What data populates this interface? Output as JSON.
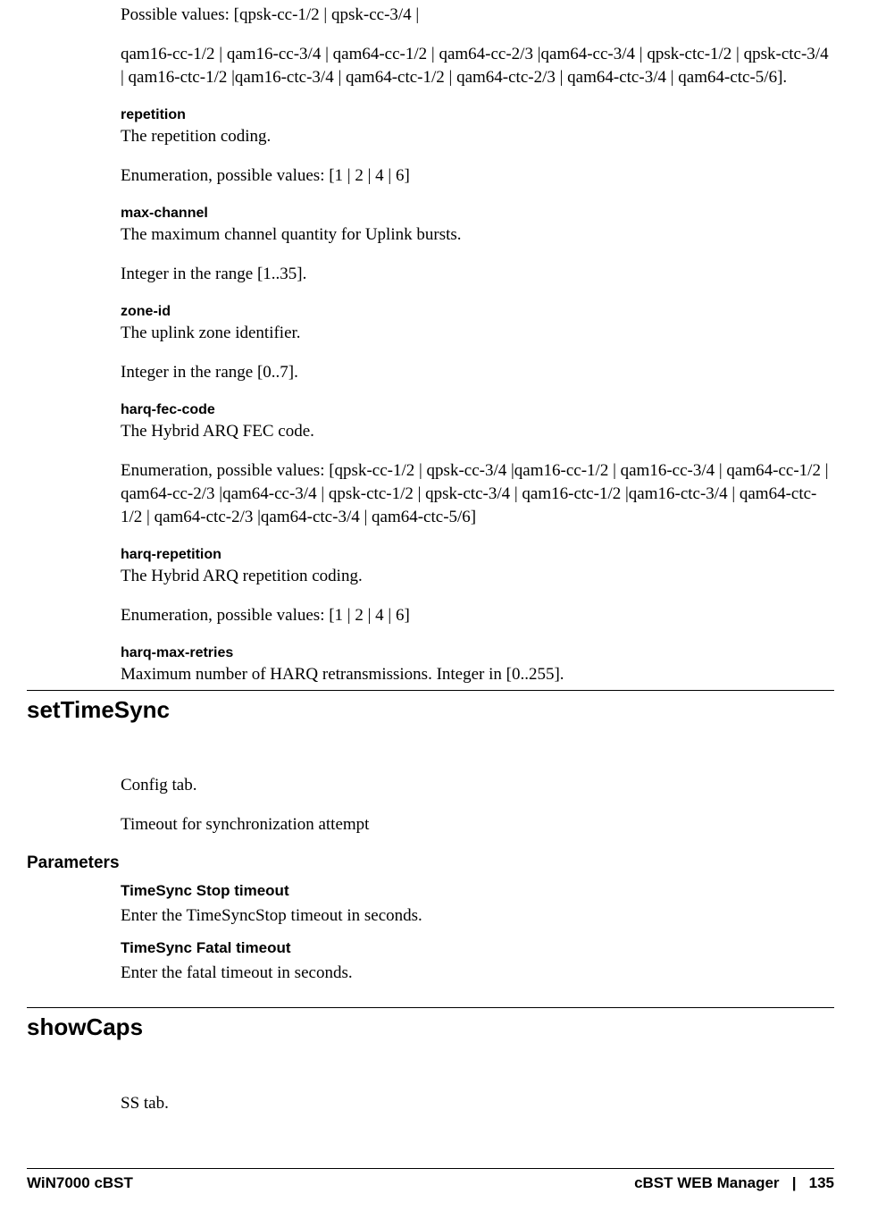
{
  "intro": {
    "possible_prefix": "Possible values: [qpsk-cc-1/2 | qpsk-cc-3/4 |",
    "possible_rest": "qam16-cc-1/2 | qam16-cc-3/4 | qam64-cc-1/2 | qam64-cc-2/3 |qam64-cc-3/4 | qpsk-ctc-1/2 | qpsk-ctc-3/4 | qam16-ctc-1/2 |qam16-ctc-3/4 | qam64-ctc-1/2 | qam64-ctc-2/3 | qam64-ctc-3/4 | qam64-ctc-5/6]."
  },
  "params1": [
    {
      "name": "repetition",
      "desc": "The repetition coding.",
      "extra": "Enumeration, possible values: [1 | 2 | 4 | 6]"
    },
    {
      "name": "max-channel",
      "desc": "The maximum channel quantity for Uplink bursts.",
      "extra": "Integer in the range [1..35]."
    },
    {
      "name": "zone-id",
      "desc": "The uplink zone identifier.",
      "extra": "Integer in the range [0..7]."
    },
    {
      "name": "harq-fec-code",
      "desc": "The Hybrid ARQ FEC code.",
      "extra": "Enumeration, possible values: [qpsk-cc-1/2 | qpsk-cc-3/4 |qam16-cc-1/2 | qam16-cc-3/4 | qam64-cc-1/2 | qam64-cc-2/3 |qam64-cc-3/4 | qpsk-ctc-1/2 | qpsk-ctc-3/4 | qam16-ctc-1/2 |qam16-ctc-3/4 | qam64-ctc-1/2 | qam64-ctc-2/3 |qam64-ctc-3/4 | qam64-ctc-5/6]"
    },
    {
      "name": "harq-repetition",
      "desc": "The Hybrid ARQ repetition coding.",
      "extra": "Enumeration, possible values: [1 | 2 | 4 | 6]"
    },
    {
      "name": "harq-max-retries",
      "desc": "Maximum number of HARQ retransmissions. Integer in [0..255].",
      "extra": ""
    }
  ],
  "section1": {
    "title": "setTimeSync",
    "line1": "Config tab.",
    "line2": "Timeout for synchronization attempt",
    "params_heading": "Parameters",
    "params": [
      {
        "name": "TimeSync Stop timeout",
        "desc": "Enter the TimeSyncStop timeout in seconds."
      },
      {
        "name": "TimeSync Fatal timeout",
        "desc": "Enter the fatal timeout in seconds."
      }
    ]
  },
  "section2": {
    "title": "showCaps",
    "line1": "SS tab."
  },
  "footer": {
    "left": "WiN7000 cBST",
    "right": "cBST WEB Manager   |   135"
  }
}
